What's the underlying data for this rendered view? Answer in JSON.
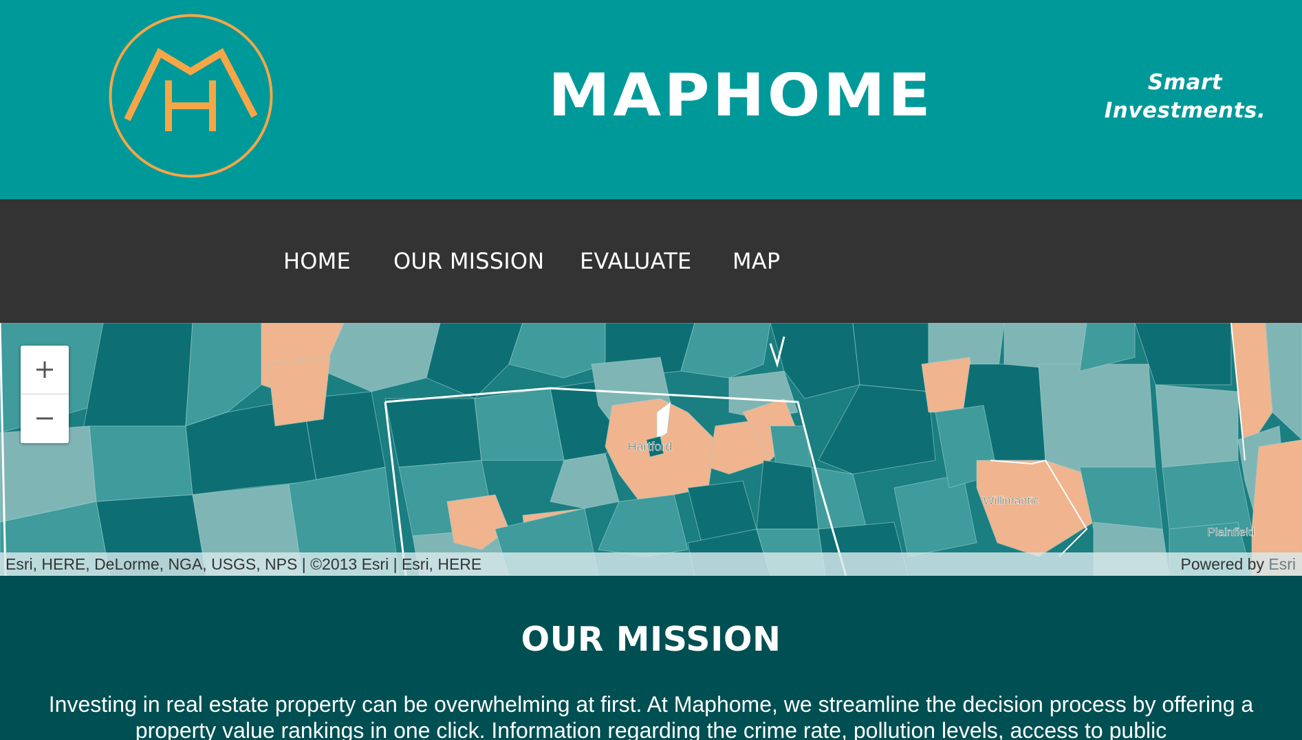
{
  "header": {
    "logo_icon": "mh-monogram-logo",
    "brand_name": "MAPHOME",
    "tagline_line1": "Smart",
    "tagline_line2": "Investments.",
    "colors": {
      "header_bg": "#00999a",
      "logo_orange": "#f7a645"
    }
  },
  "nav": {
    "items": [
      {
        "label": "HOME"
      },
      {
        "label": "OUR MISSION"
      },
      {
        "label": "EVALUATE"
      },
      {
        "label": "MAP"
      }
    ],
    "colors": {
      "nav_bg": "#333333"
    }
  },
  "map": {
    "zoom_in_icon": "plus-icon",
    "zoom_out_icon": "minus-icon",
    "place_labels": [
      "Hartford",
      "Willimantic",
      "Plainfield"
    ],
    "attribution": "Esri, HERE, DeLorme, NGA, USGS, NPS | ©2013 Esri | Esri, HERE",
    "powered_by_prefix": "Powered by",
    "powered_by_link": "Esri",
    "colors": {
      "dark_teal": "#0d6f73",
      "mid_teal": "#3f9b9c",
      "light_teal": "#7fb6b5",
      "peach": "#f0b48e"
    }
  },
  "mission": {
    "heading": "OUR MISSION",
    "body": "Investing in real estate property can be overwhelming at first. At Maphome, we streamline the decision process by offering a property value rankings in one click. Information regarding the crime rate, pollution levels, access to public",
    "colors": {
      "section_bg": "#004f52"
    }
  }
}
